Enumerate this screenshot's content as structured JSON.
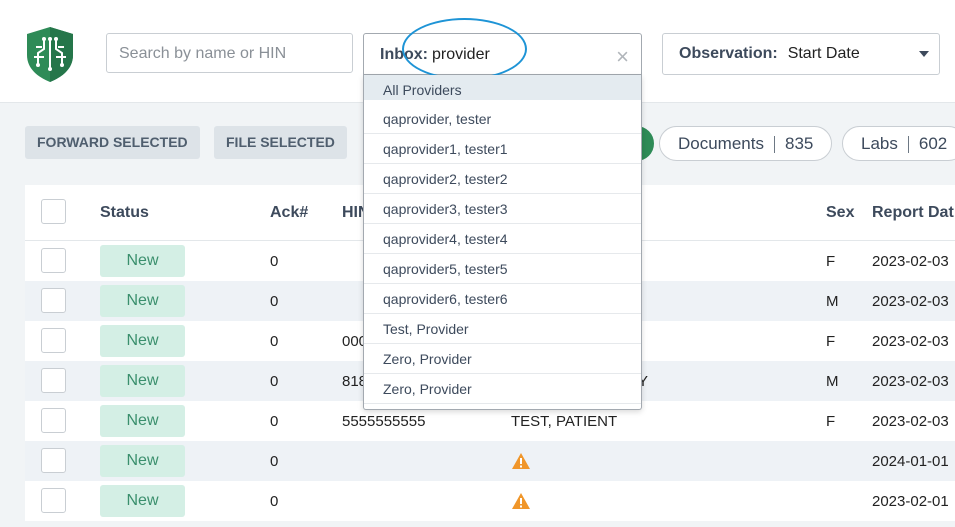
{
  "search": {
    "placeholder": "Search by name or HIN"
  },
  "inbox": {
    "label": "Inbox:",
    "value": "provider"
  },
  "observation": {
    "label": "Observation:",
    "value": "Start Date"
  },
  "actions": {
    "forward": "FORWARD SELECTED",
    "file": "FILE SELECTED"
  },
  "tabs": [
    {
      "label": "Documents",
      "count": "835"
    },
    {
      "label": "Labs",
      "count": "602"
    }
  ],
  "columns": {
    "status": "Status",
    "ack": "Ack#",
    "hin": "HIN",
    "sex": "Sex",
    "report_date": "Report Dat"
  },
  "rows": [
    {
      "status": "New",
      "ack": "0",
      "hin": "",
      "name": "",
      "sex": "F",
      "date": "2023-02-03",
      "warn": false
    },
    {
      "status": "New",
      "ack": "0",
      "hin": "",
      "name": "",
      "sex": "M",
      "date": "2023-02-03",
      "warn": false
    },
    {
      "status": "New",
      "ack": "0",
      "hin": "000",
      "name": "",
      "sex": "F",
      "date": "2023-02-03",
      "warn": false
    },
    {
      "status": "New",
      "ack": "0",
      "hin": "818",
      "name": "Y",
      "sex": "M",
      "date": "2023-02-03",
      "warn": false
    },
    {
      "status": "New",
      "ack": "0",
      "hin": "5555555555",
      "name": "TEST, PATIENT",
      "sex": "F",
      "date": "2023-02-03",
      "warn": false
    },
    {
      "status": "New",
      "ack": "0",
      "hin": "",
      "name": "",
      "sex": "",
      "date": "2024-01-01",
      "warn": true
    },
    {
      "status": "New",
      "ack": "0",
      "hin": "",
      "name": "",
      "sex": "",
      "date": "2023-02-01",
      "warn": true
    }
  ],
  "dropdown": {
    "items": [
      "All Providers",
      "qaprovider, tester",
      "qaprovider1, tester1",
      "qaprovider2, tester2",
      "qaprovider3, tester3",
      "qaprovider4, tester4",
      "qaprovider5, tester5",
      "qaprovider6, tester6",
      "Test, Provider",
      "Zero, Provider",
      "Zero, Provider"
    ]
  },
  "colors": {
    "brand": "#2e8b57",
    "badge_bg": "#d4efe5",
    "highlight": "#1e94d6"
  },
  "icons": {
    "logo": "circuit-shield-icon",
    "clear": "close-icon",
    "caret": "chevron-down-icon",
    "warning": "warning-icon"
  }
}
